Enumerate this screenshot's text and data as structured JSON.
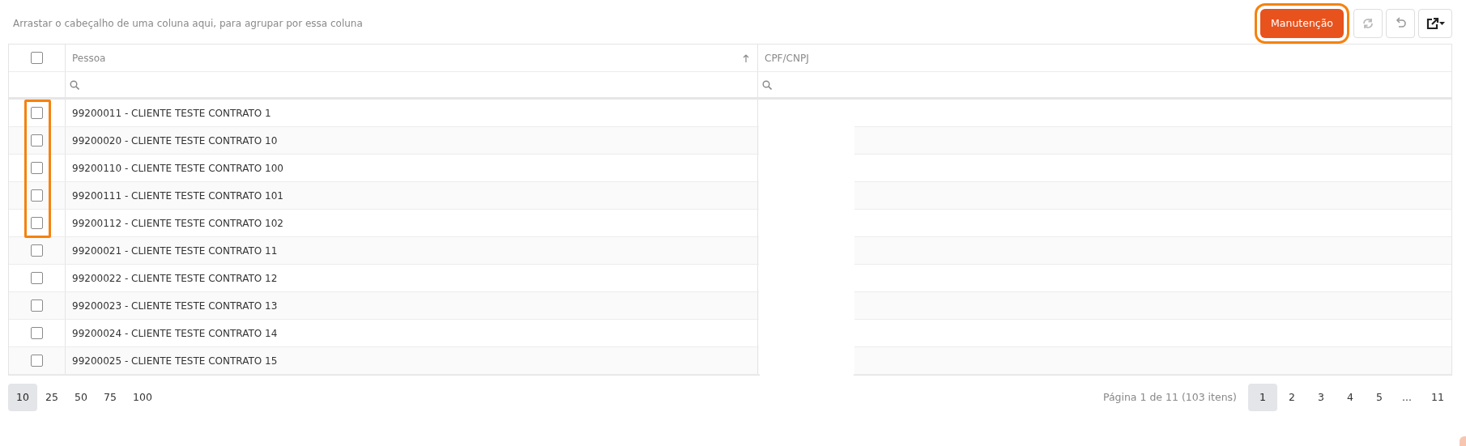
{
  "group_panel": {
    "hint": "Arrastar o cabeçalho de uma coluna aqui, para agrupar por essa coluna"
  },
  "toolbar": {
    "maintenance_button": {
      "label": "Manutenção",
      "highlighted": true
    }
  },
  "table": {
    "select_all": {
      "checked": false
    },
    "columns": [
      {
        "label": "Pessoa",
        "sort_arrow": true
      },
      {
        "label": "CPF/CNPJ",
        "sort_arrow": false
      }
    ],
    "rows": [
      {
        "pessoa": "99200011 - CLIENTE TESTE CONTRATO 1",
        "checked": false,
        "highlighted": true
      },
      {
        "pessoa": "99200020 - CLIENTE TESTE CONTRATO 10",
        "checked": false,
        "highlighted": true
      },
      {
        "pessoa": "99200110 - CLIENTE TESTE CONTRATO 100",
        "checked": false,
        "highlighted": true
      },
      {
        "pessoa": "99200111 - CLIENTE TESTE CONTRATO 101",
        "checked": false,
        "highlighted": true
      },
      {
        "pessoa": "99200112 - CLIENTE TESTE CONTRATO 102",
        "checked": false,
        "highlighted": true
      },
      {
        "pessoa": "99200021 - CLIENTE TESTE CONTRATO 11",
        "checked": false,
        "highlighted": false
      },
      {
        "pessoa": "99200022 - CLIENTE TESTE CONTRATO 12",
        "checked": false,
        "highlighted": false
      },
      {
        "pessoa": "99200023 - CLIENTE TESTE CONTRATO 13",
        "checked": false,
        "highlighted": false
      },
      {
        "pessoa": "99200024 - CLIENTE TESTE CONTRATO 14",
        "checked": false,
        "highlighted": false
      },
      {
        "pessoa": "99200025 - CLIENTE TESTE CONTRATO 15",
        "checked": false,
        "highlighted": false
      }
    ]
  },
  "pager": {
    "page_sizes": [
      {
        "label": "10",
        "selected": true
      },
      {
        "label": "25",
        "selected": false
      },
      {
        "label": "50",
        "selected": false
      },
      {
        "label": "75",
        "selected": false
      },
      {
        "label": "100",
        "selected": false
      }
    ],
    "info": "Página 1 de 11 (103 itens)",
    "pages": [
      {
        "label": "1",
        "kind": "page",
        "selected": true
      },
      {
        "label": "2",
        "kind": "page",
        "selected": false
      },
      {
        "label": "3",
        "kind": "page",
        "selected": false
      },
      {
        "label": "4",
        "kind": "page",
        "selected": false
      },
      {
        "label": "5",
        "kind": "page",
        "selected": false
      },
      {
        "label": "...",
        "kind": "ellipsis"
      },
      {
        "label": "11",
        "kind": "page",
        "selected": false
      }
    ]
  }
}
